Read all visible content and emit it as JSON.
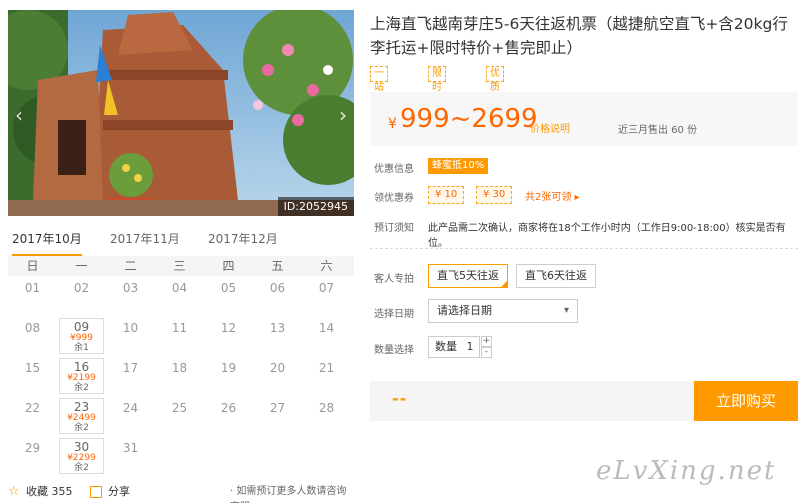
{
  "hero": {
    "id_label": "ID:2052945",
    "prev_arrow": "‹",
    "next_arrow": "›"
  },
  "calendar": {
    "months": [
      "2017年10月",
      "2017年11月",
      "2017年12月"
    ],
    "active_month_index": 0,
    "weekdays": [
      "日",
      "一",
      "二",
      "三",
      "四",
      "五",
      "六"
    ],
    "rows": [
      [
        {
          "d": "01"
        },
        {
          "d": "02"
        },
        {
          "d": "03"
        },
        {
          "d": "04"
        },
        {
          "d": "05"
        },
        {
          "d": "06"
        },
        {
          "d": "07"
        }
      ],
      [
        {
          "d": "08"
        },
        {
          "d": "09",
          "price": "¥999",
          "left": "余1"
        },
        {
          "d": "10"
        },
        {
          "d": "11"
        },
        {
          "d": "12"
        },
        {
          "d": "13"
        },
        {
          "d": "14"
        }
      ],
      [
        {
          "d": "15"
        },
        {
          "d": "16",
          "price": "¥2199",
          "left": "余2"
        },
        {
          "d": "17"
        },
        {
          "d": "18"
        },
        {
          "d": "19"
        },
        {
          "d": "20"
        },
        {
          "d": "21"
        }
      ],
      [
        {
          "d": "22"
        },
        {
          "d": "23",
          "price": "¥2499",
          "left": "余2"
        },
        {
          "d": "24"
        },
        {
          "d": "25"
        },
        {
          "d": "26"
        },
        {
          "d": "27"
        },
        {
          "d": "28"
        }
      ],
      [
        {
          "d": "29"
        },
        {
          "d": "30",
          "price": "¥2299",
          "left": "余2"
        },
        {
          "d": "31"
        }
      ]
    ]
  },
  "footer": {
    "favorite": "收藏 355",
    "share": "分享",
    "tip": "· 如需预订更多人数请咨询客服"
  },
  "product": {
    "title": "上海直飞越南芽庄5-6天往返机票（越捷航空直飞+含20kg行李托运+限时特价+售完即止）",
    "tags": [
      "一站式直达",
      "限时特价",
      "优质航空"
    ],
    "currency": "¥",
    "price_range": "999~2699",
    "price_note": "价格说明",
    "sold": "近三月售出 60 份",
    "promo_label": "优惠信息",
    "promo_badge": "蜂蜜抵10%",
    "coupon_label": "领优惠券",
    "coupons": [
      "¥ 10",
      "¥ 30"
    ],
    "coupon_link": "共2张可领 ▸",
    "notice_label": "预订须知",
    "notice": "此产品需二次确认，商家将在18个工作小时内（工作日9:00-18:00）核实是否有位。",
    "option_label": "客人专拍",
    "options": [
      "直飞5天往返",
      "直飞6天往返"
    ],
    "selected_option_index": 0,
    "date_label": "选择日期",
    "date_placeholder": "请选择日期",
    "qty_label": "数量选择",
    "qty_text": "数量",
    "qty_value": "1",
    "price_dash": "--",
    "buy_label": "立即购买"
  },
  "watermark": "eLvXing.net",
  "colors": {
    "accent": "#ff9900",
    "price": "#ff6600"
  }
}
